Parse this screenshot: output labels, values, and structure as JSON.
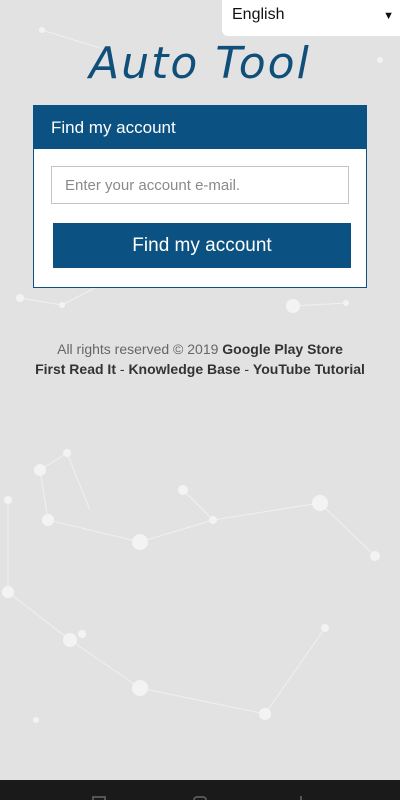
{
  "language_selector": {
    "selected": "English",
    "caret": "▼"
  },
  "logo": {
    "text": "Auto Tool"
  },
  "card": {
    "title": "Find my account",
    "email_placeholder": "Enter your account e-mail.",
    "email_value": "",
    "submit_label": "Find my account"
  },
  "footer": {
    "rights_text": "All rights reserved © 2019",
    "store_link": "Google Play Store",
    "link_first_read": "First Read It",
    "separator": "-",
    "link_knowledge": "Knowledge Base",
    "link_youtube": "YouTube Tutorial"
  },
  "colors": {
    "brand": "#0b5283",
    "logo": "#0f4f7a",
    "background": "#e2e2e2"
  }
}
